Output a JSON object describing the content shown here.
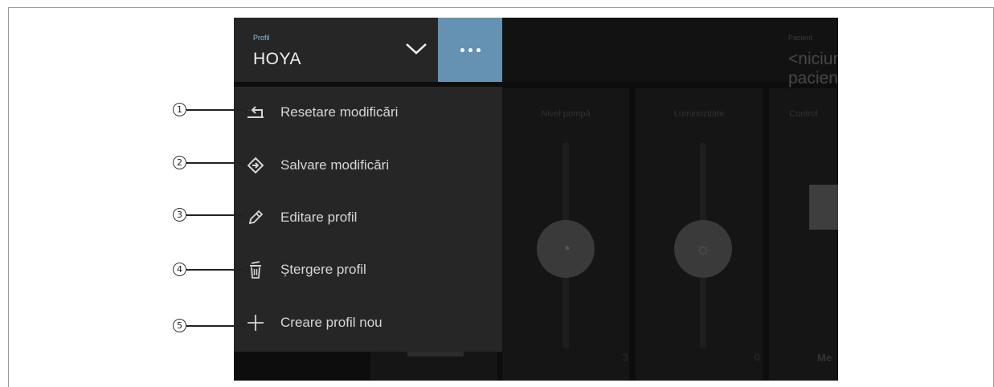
{
  "profile": {
    "label": "Profil",
    "name": "HOYA"
  },
  "patient": {
    "label": "Pacient",
    "name": "<niciun pacient>"
  },
  "menu": {
    "items": [
      {
        "label": "Resetare modificări",
        "icon": "reset-icon",
        "callout": "1"
      },
      {
        "label": "Salvare modificări",
        "icon": "save-icon",
        "callout": "2"
      },
      {
        "label": "Editare profil",
        "icon": "pencil-icon",
        "callout": "3"
      },
      {
        "label": "Ștergere profil",
        "icon": "trash-icon",
        "callout": "4"
      },
      {
        "label": "Creare profil nou",
        "icon": "plus-icon",
        "callout": "5"
      }
    ]
  },
  "panels": {
    "pump": {
      "title": "Nivel pompă",
      "value": "3"
    },
    "light": {
      "title": "Luminozitate",
      "value": "0"
    },
    "control": {
      "title": "Control",
      "value": "Me"
    }
  },
  "colors": {
    "accent": "#6592b2",
    "profile_label": "#8ac3e6",
    "menu_bg": "#262626"
  }
}
